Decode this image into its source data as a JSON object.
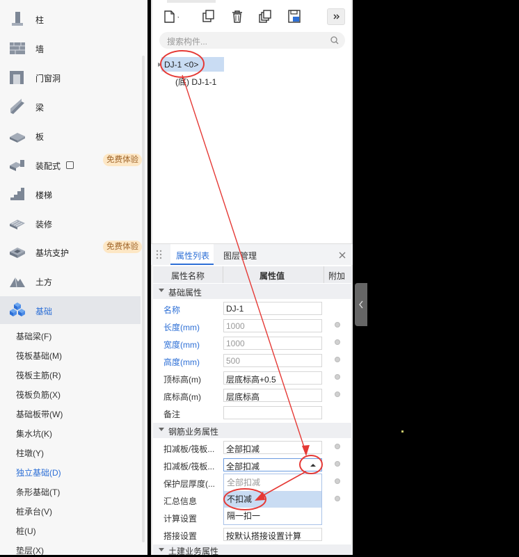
{
  "sidebar": {
    "categories": [
      {
        "label": "柱",
        "icon": "column-icon"
      },
      {
        "label": "墙",
        "icon": "wall-icon"
      },
      {
        "label": "门窗洞",
        "icon": "door-window-icon"
      },
      {
        "label": "梁",
        "icon": "beam-icon"
      },
      {
        "label": "板",
        "icon": "slab-icon"
      },
      {
        "label": "装配式",
        "icon": "prefab-icon"
      },
      {
        "label": "楼梯",
        "icon": "stairs-icon"
      },
      {
        "label": "装修",
        "icon": "decoration-icon"
      },
      {
        "label": "基坑支护",
        "icon": "pit-support-icon"
      },
      {
        "label": "土方",
        "icon": "earthwork-icon"
      },
      {
        "label": "基础",
        "icon": "foundation-icon"
      }
    ],
    "free_badge": "免费体验",
    "sub_items": [
      "基础梁(F)",
      "筏板基础(M)",
      "筏板主筋(R)",
      "筏板负筋(X)",
      "基础板带(W)",
      "集水坑(K)",
      "柱墩(Y)",
      "独立基础(D)",
      "条形基础(T)",
      "桩承台(V)",
      "桩(U)",
      "垫层(X)"
    ]
  },
  "component_panel": {
    "search_placeholder": "搜索构件...",
    "tree_root": "DJ-1 <0>",
    "tree_child": "(底) DJ-1-1"
  },
  "property_panel": {
    "tabs": [
      "属性列表",
      "图层管理"
    ],
    "headers": [
      "属性名称",
      "属性值",
      "附加"
    ],
    "group1": "基础属性",
    "rows1": [
      {
        "name": "名称",
        "value": "DJ-1"
      },
      {
        "name": "长度(mm)",
        "value": "1000"
      },
      {
        "name": "宽度(mm)",
        "value": "1000"
      },
      {
        "name": "高度(mm)",
        "value": "500"
      },
      {
        "name": "顶标高(m)",
        "value": "层底标高+0.5"
      },
      {
        "name": "底标高(m)",
        "value": "层底标高"
      },
      {
        "name": "备注",
        "value": ""
      }
    ],
    "group2": "钢筋业务属性",
    "rows2": [
      {
        "name": "扣减板/筏板...",
        "value": "全部扣减"
      },
      {
        "name": "扣减板/筏板...",
        "value": "全部扣减"
      },
      {
        "name": "保护层厚度(...",
        "value": ""
      },
      {
        "name": "汇总信息",
        "value": ""
      },
      {
        "name": "计算设置",
        "value": ""
      },
      {
        "name": "搭接设置",
        "value": "按默认搭接设置计算"
      }
    ],
    "group3": "土建业务属性",
    "dropdown_options": [
      "全部扣减",
      "不扣减",
      "隔一扣一"
    ]
  },
  "colors": {
    "accent": "#2d6fd6",
    "annotation": "#e53935",
    "badge_bg": "#fde7c5",
    "badge_text": "#a0652a"
  }
}
